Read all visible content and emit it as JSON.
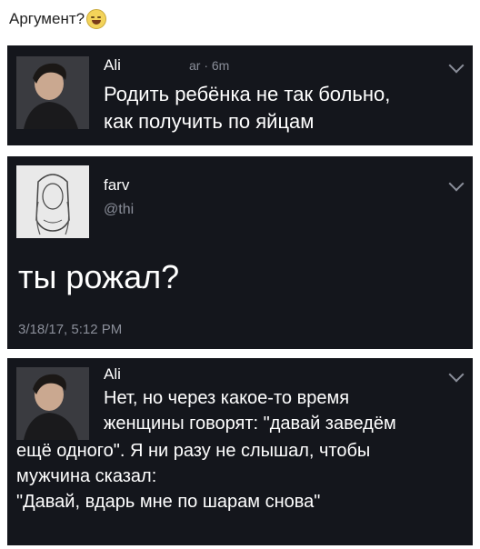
{
  "caption": {
    "text": "Аргумент?"
  },
  "tweet1": {
    "author": "Ali",
    "meta": "ar · 6m",
    "text_line1": "Родить ребёнка не так больно,",
    "text_line2": "как получить по яйцам"
  },
  "tweet2": {
    "author": "farv",
    "handle": "@thi",
    "text": "ты рожал?",
    "timestamp": "3/18/17, 5:12 PM"
  },
  "tweet3": {
    "author": "Ali",
    "lines": [
      "Нет, но через какое-то время",
      "женщины говорят: \"давай заведём",
      "ещё одного\". Я ни разу не слышал, чтобы",
      "мужчина сказал:",
      "\"Давай, вдарь мне по шарам снова\""
    ]
  },
  "icons": {
    "emoji": "laughing-face-icon",
    "more": "chevron-down-icon"
  }
}
